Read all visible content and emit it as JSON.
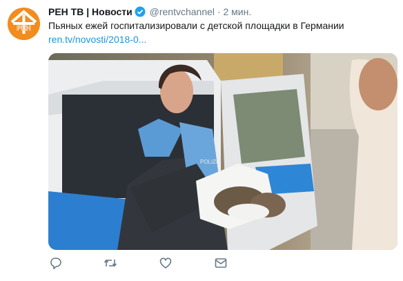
{
  "account": {
    "name": "РЕН ТВ | Новости",
    "handle": "@rentvchannel",
    "separator": "·",
    "time": "2 мин.",
    "verified": true,
    "avatar_logo_text": "РЕН"
  },
  "tweet": {
    "text": "Пьяных ежей госпитализировали с детской площадки в Германии",
    "link": "ren.tv/novosti/2018-0..."
  },
  "media": {
    "badge_text": "POLIZEI"
  },
  "actions": [
    {
      "icon": "reply-icon"
    },
    {
      "icon": "retweet-icon"
    },
    {
      "icon": "like-icon"
    },
    {
      "icon": "message-icon"
    }
  ],
  "colors": {
    "brand": "#f28c1e",
    "link": "#1b95e0",
    "muted": "#657786",
    "verified": "#1da1f2"
  }
}
